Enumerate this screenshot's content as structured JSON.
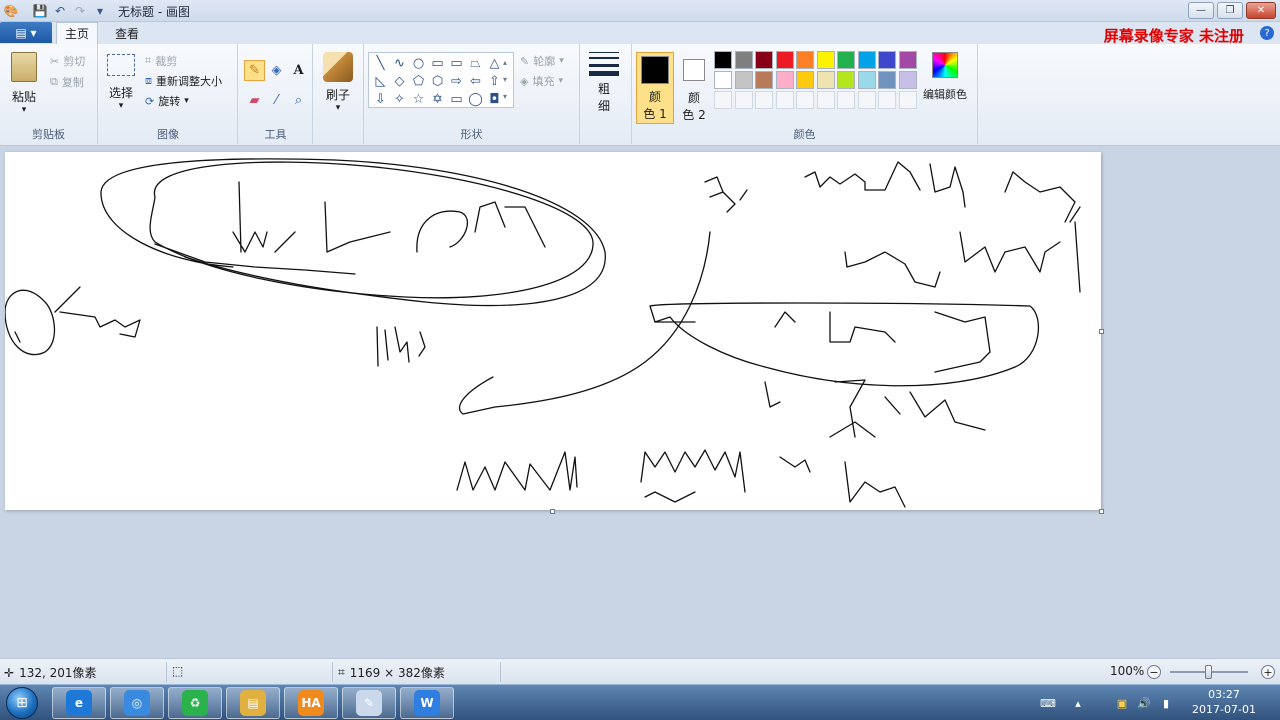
{
  "window": {
    "title": "无标题 - 画图",
    "controls": {
      "minimize": "—",
      "maximize": "❐",
      "close": "✕"
    }
  },
  "tabs": {
    "file": "▤ ▾",
    "home": "主页",
    "view": "查看"
  },
  "watermark": "屏幕录像专家  未注册",
  "help": "?",
  "ribbon": {
    "clipboard": {
      "label": "剪贴板",
      "paste": "粘贴",
      "cut": "剪切",
      "copy": "复制"
    },
    "image": {
      "label": "图像",
      "select": "选择",
      "crop": "裁剪",
      "resize": "重新调整大小",
      "rotate": "旋转"
    },
    "tools": {
      "label": "工具",
      "text_tool": "A"
    },
    "brushes": {
      "label": "刷子"
    },
    "shapes": {
      "label": "形状",
      "outline": "轮廓",
      "fill": "填充",
      "items": [
        "╲",
        "∿",
        "○",
        "▭",
        "▭",
        "⏢",
        "△",
        "◺",
        "◇",
        "⬠",
        "⬡",
        "⇨",
        "⇦",
        "⇧",
        "⇩",
        "✧",
        "☆",
        "✡",
        "▭",
        "◯",
        "◘"
      ]
    },
    "size": {
      "label_top": "粗",
      "label_bottom": "细"
    },
    "colors": {
      "label": "颜色",
      "color1": {
        "top": "颜",
        "bottom": "色 1",
        "value": "#000000"
      },
      "color2": {
        "top": "颜",
        "bottom": "色 2",
        "value": "#ffffff"
      },
      "edit": "编辑颜色",
      "palette_row1": [
        "#000000",
        "#7f7f7f",
        "#880015",
        "#ed1c24",
        "#ff7f27",
        "#fff200",
        "#22b14c",
        "#00a2e8",
        "#3f48cc",
        "#a349a4"
      ],
      "palette_row2": [
        "#ffffff",
        "#c3c3c3",
        "#b97a57",
        "#ffaec9",
        "#ffc90e",
        "#efe4b0",
        "#b5e61d",
        "#99d9ea",
        "#7092be",
        "#c8bfe7"
      ]
    }
  },
  "status": {
    "cursor_pos": "132, 201像素",
    "canvas_size": "1169 × 382像素",
    "zoom": "100%",
    "zoom_level": 0.5
  },
  "taskbar": {
    "apps": [
      {
        "name": "ie",
        "label": "e",
        "color": "#1e78d7"
      },
      {
        "name": "browser",
        "label": "◎",
        "color": "#3a8be0"
      },
      {
        "name": "recycle",
        "label": "♻",
        "color": "#2bb24c"
      },
      {
        "name": "explorer",
        "label": "▤",
        "color": "#e0b040"
      },
      {
        "name": "ha",
        "label": "HA",
        "color": "#f08a1c"
      },
      {
        "name": "paint",
        "label": "✎",
        "color": "#c9d8ea"
      },
      {
        "name": "wps",
        "label": "W",
        "color": "#2f7fe0"
      }
    ],
    "time": "03:27",
    "date": "2017-07-01"
  }
}
